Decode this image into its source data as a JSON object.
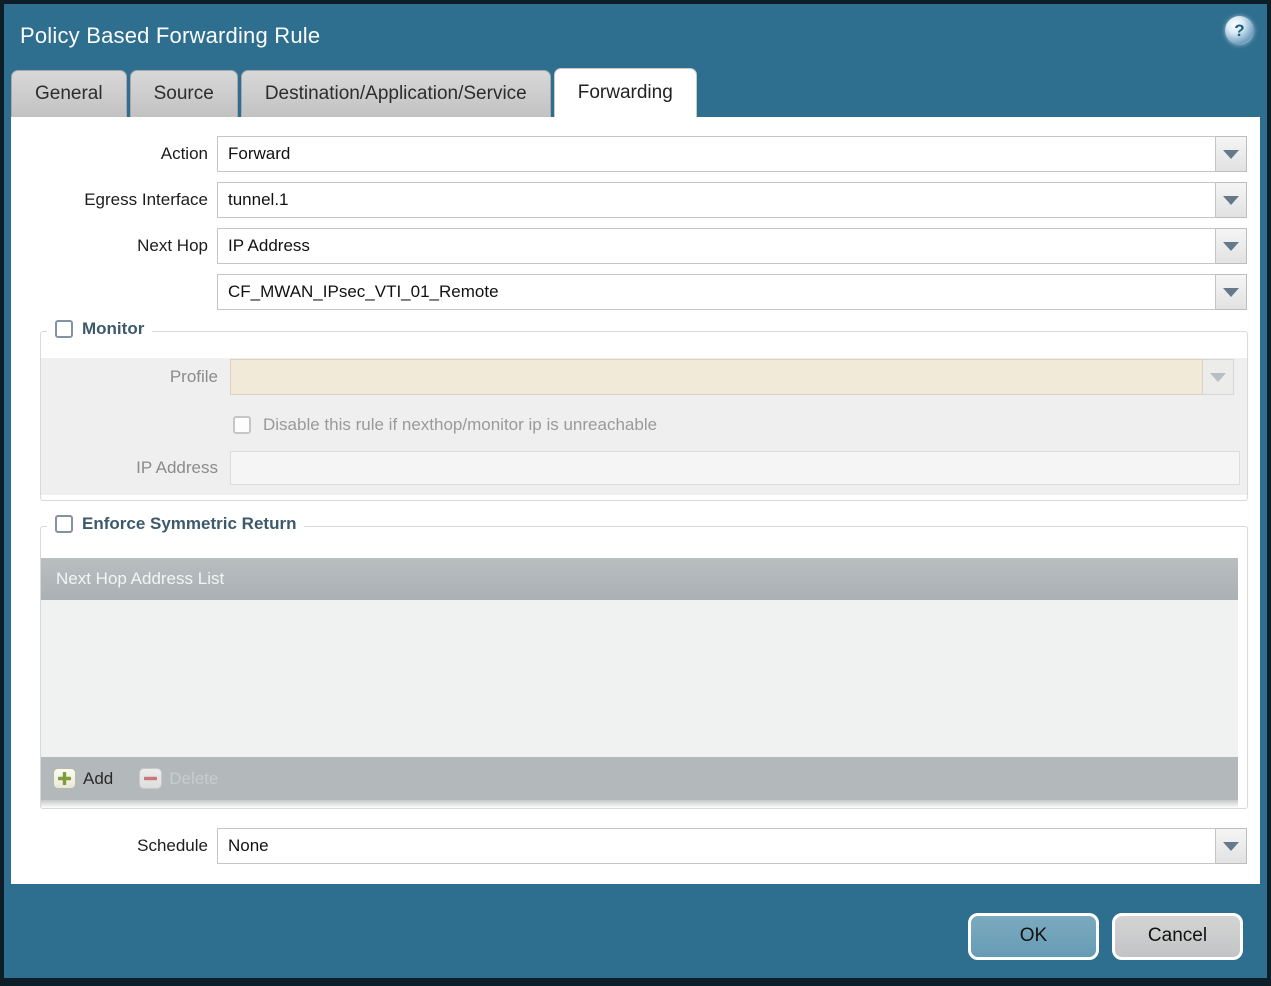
{
  "window": {
    "title": "Policy Based Forwarding Rule",
    "help_glyph": "?"
  },
  "tabs": [
    {
      "label": "General",
      "active": false
    },
    {
      "label": "Source",
      "active": false
    },
    {
      "label": "Destination/Application/Service",
      "active": false
    },
    {
      "label": "Forwarding",
      "active": true
    }
  ],
  "form": {
    "action": {
      "label": "Action",
      "value": "Forward"
    },
    "egress_interface": {
      "label": "Egress Interface",
      "value": "tunnel.1"
    },
    "next_hop": {
      "label": "Next Hop",
      "value": "IP Address"
    },
    "next_hop_address": {
      "value": "CF_MWAN_IPsec_VTI_01_Remote"
    },
    "monitor": {
      "label": "Monitor",
      "checked": false,
      "profile": {
        "label": "Profile",
        "value": ""
      },
      "disable_rule": {
        "label": "Disable this rule if nexthop/monitor ip is unreachable",
        "checked": false
      },
      "ip_address": {
        "label": "IP Address",
        "value": ""
      }
    },
    "enforce_symmetric_return": {
      "label": "Enforce Symmetric Return",
      "checked": false,
      "table": {
        "header": "Next Hop Address List",
        "rows": []
      },
      "add_label": "Add",
      "delete_label": "Delete"
    },
    "schedule": {
      "label": "Schedule",
      "value": "None"
    }
  },
  "footer": {
    "ok_label": "OK",
    "cancel_label": "Cancel"
  },
  "colors": {
    "titlebar_teal": "#2e6e8e",
    "window_border": "#0e1e29",
    "disabled_field_beige": "#f2ead9",
    "group_label_text": "#3d5a6c",
    "table_chrome_gray": "#b3b8bb",
    "ok_button_blue": "#6fa1b9",
    "add_icon_green": "#7f9c3a",
    "delete_icon_red": "#c05a5a"
  }
}
